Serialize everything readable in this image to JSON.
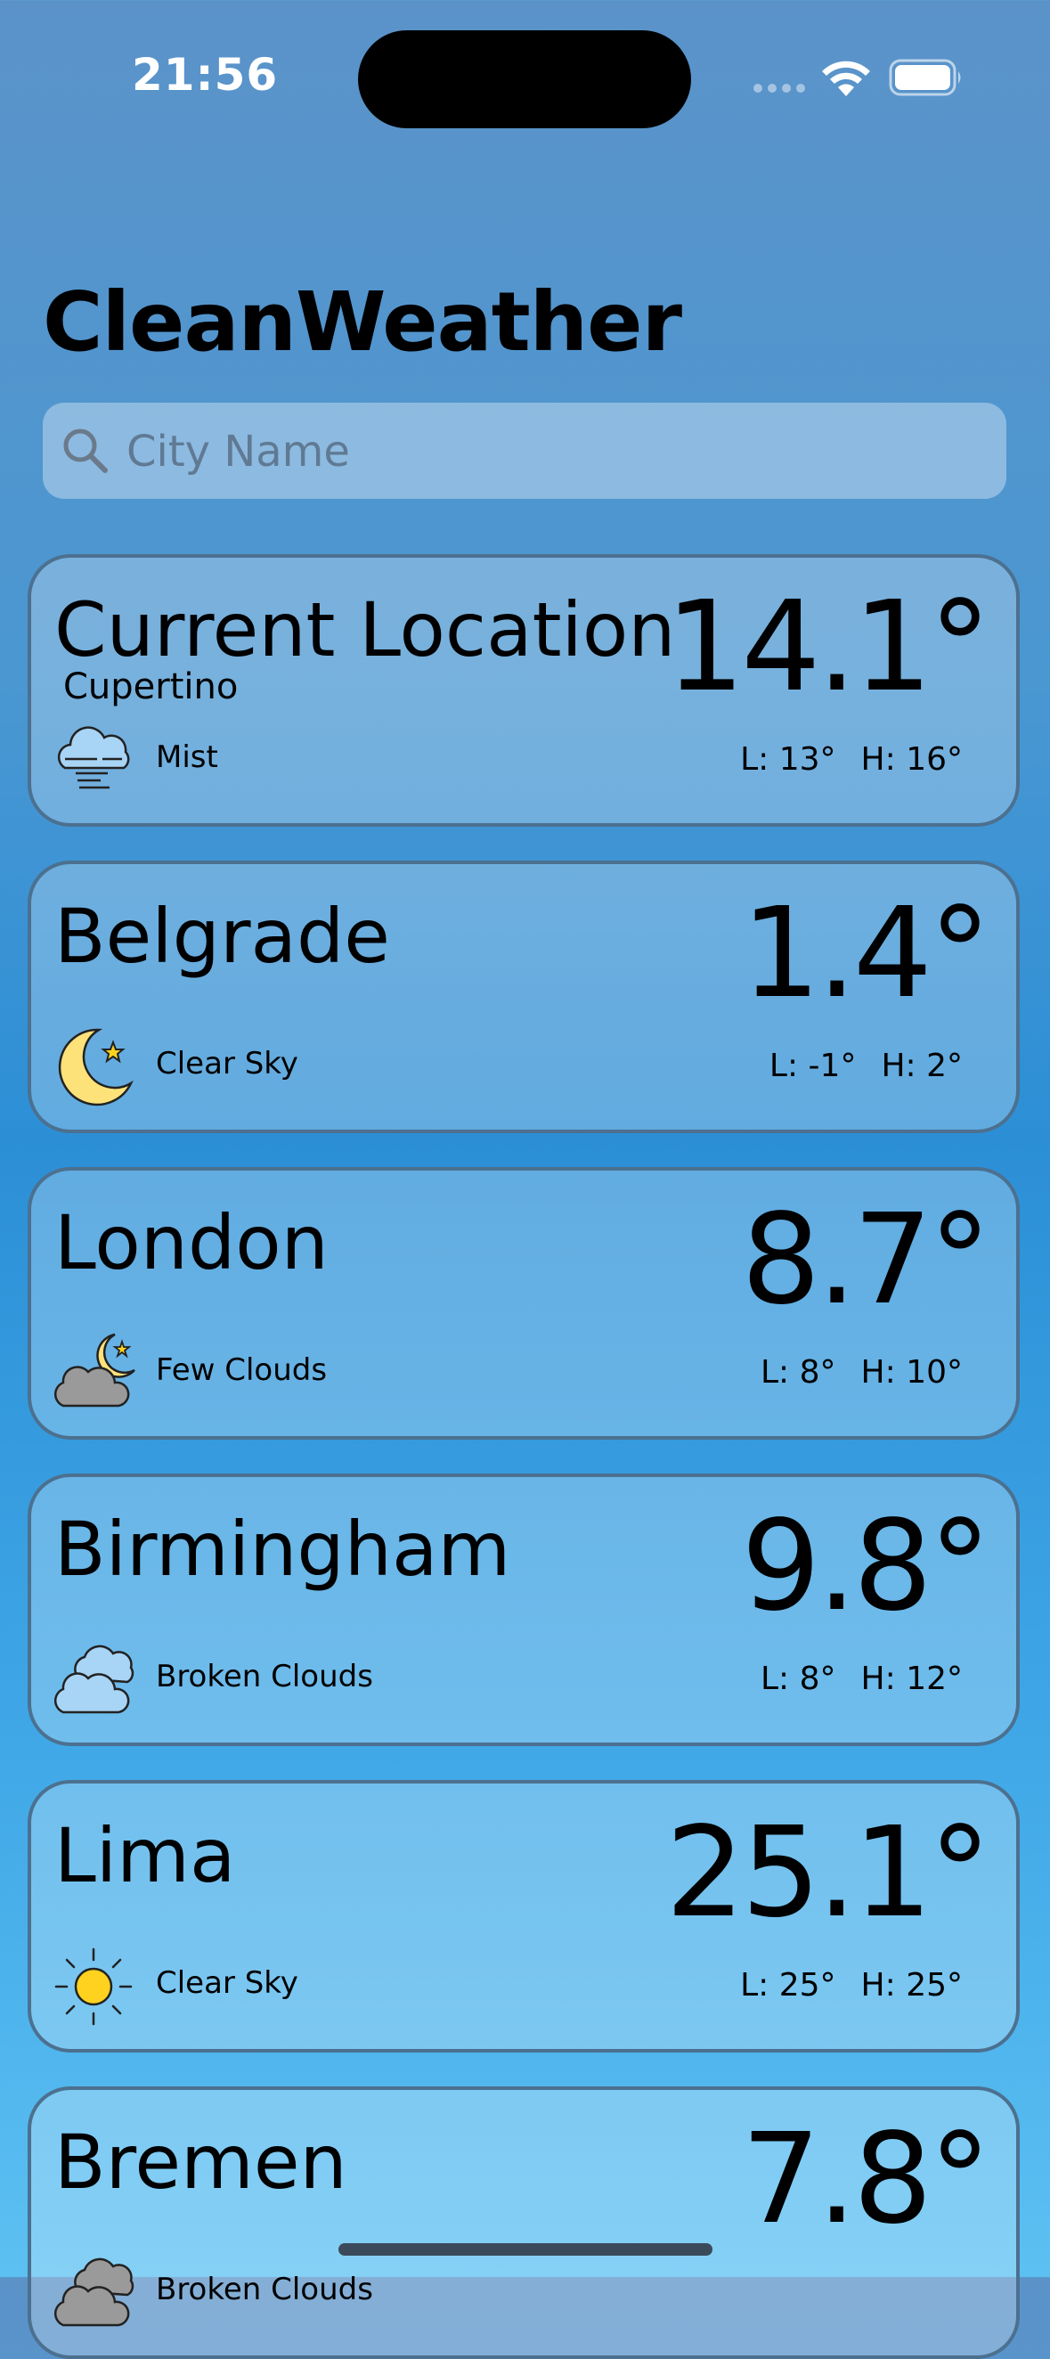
{
  "status": {
    "time": "21:56"
  },
  "app": {
    "title": "CleanWeather"
  },
  "search": {
    "placeholder": "City Name",
    "value": ""
  },
  "cards": [
    {
      "name": "Current Location",
      "subtitle": "Cupertino",
      "temp": "14.1°",
      "description": "Mist",
      "low": "L: 13°",
      "high": "H: 16°",
      "icon": "mist-cloud-icon"
    },
    {
      "name": "Belgrade",
      "subtitle": "",
      "temp": "1.4°",
      "description": "Clear Sky",
      "low": "L: -1°",
      "high": "H: 2°",
      "icon": "moon-star-icon"
    },
    {
      "name": "London",
      "subtitle": "",
      "temp": "8.7°",
      "description": "Few Clouds",
      "low": "L: 8°",
      "high": "H: 10°",
      "icon": "cloud-moon-icon"
    },
    {
      "name": "Birmingham",
      "subtitle": "",
      "temp": "9.8°",
      "description": "Broken Clouds",
      "low": "L: 8°",
      "high": "H: 12°",
      "icon": "broken-clouds-icon"
    },
    {
      "name": "Lima",
      "subtitle": "",
      "temp": "25.1°",
      "description": "Clear Sky",
      "low": "L: 25°",
      "high": "H: 25°",
      "icon": "sun-icon"
    },
    {
      "name": "Bremen",
      "subtitle": "",
      "temp": "7.8°",
      "description": "Broken Clouds",
      "low": "",
      "high": "",
      "icon": "broken-clouds-icon"
    }
  ],
  "colors": {
    "background_top": "#5b93c9",
    "background_bottom": "#5cc0f2",
    "card_border": "#4c708f",
    "sun": "#ffd21f",
    "moon": "#fde27a",
    "cloud_grey": "#9a9a9a",
    "cloud_blue": "#a8d4f5"
  }
}
